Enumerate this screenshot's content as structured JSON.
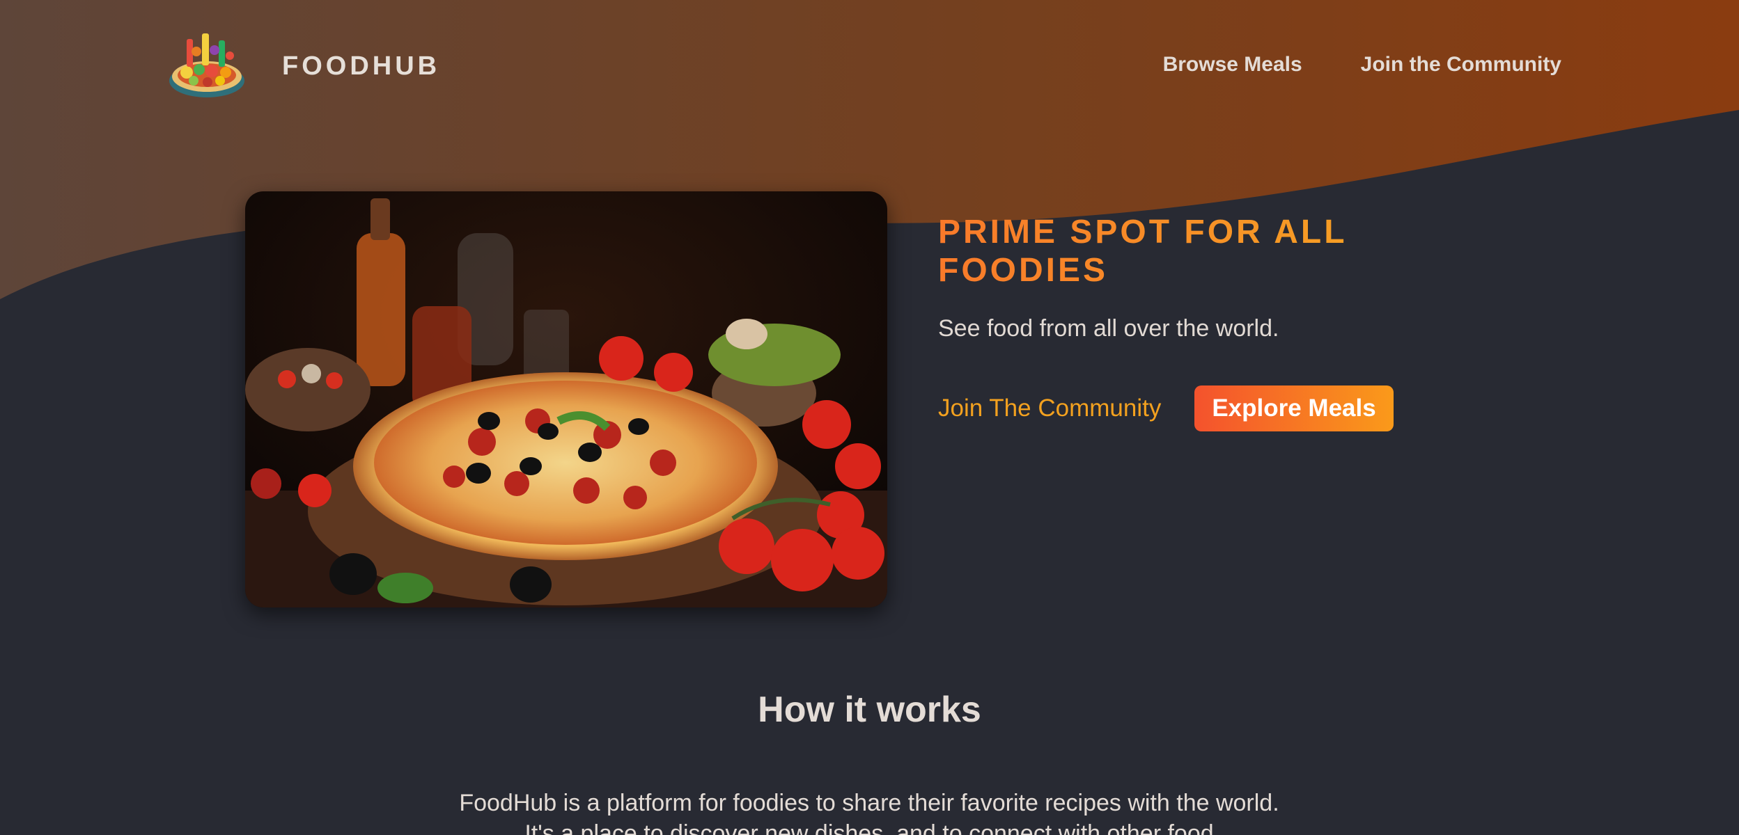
{
  "brand": {
    "name": "FOODHUB",
    "logo_icon": "food-platter-icon"
  },
  "nav": {
    "items": [
      {
        "label": "Browse Meals"
      },
      {
        "label": "Join the Community"
      }
    ]
  },
  "hero": {
    "image_icon": "pizza-photo",
    "title": "PRIME SPOT FOR ALL FOODIES",
    "subtitle": "See food from all over the world.",
    "cta_link": "Join The Community",
    "cta_button": "Explore Meals"
  },
  "how_it_works": {
    "title": "How it works",
    "text": "FoodHub is a platform for foodies to share their favorite recipes with the world. It's a place to discover new dishes, and to connect with other food"
  },
  "colors": {
    "background": "#282a33",
    "header_gradient_start": "#5e4539",
    "header_gradient_end": "#8a3c10",
    "accent_orange": "#f97a2a",
    "accent_amber": "#f5a623"
  }
}
